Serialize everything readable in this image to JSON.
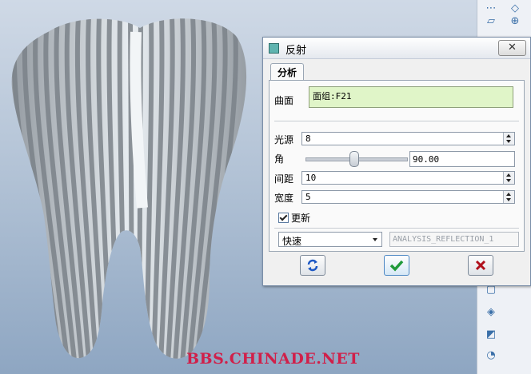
{
  "watermark": "BBS.CHINADE.NET",
  "dialog": {
    "title": "反射",
    "close_glyph": "✕",
    "tab_label": "分析",
    "surface": {
      "label": "曲面",
      "value": "面组:F21"
    },
    "light_source": {
      "label": "光源",
      "value": "8"
    },
    "angle": {
      "label": "角",
      "value": "90.00",
      "slider_fraction": 0.5
    },
    "spacing": {
      "label": "间距",
      "value": "10"
    },
    "width": {
      "label": "宽度",
      "value": "5"
    },
    "update": {
      "label": "更新",
      "checked": true
    },
    "mode": {
      "value": "快速"
    },
    "analysis_name": "ANALYSIS_REFLECTION_1",
    "buttons": [
      "refresh-icon",
      "ok-check-icon",
      "cancel-x-icon"
    ]
  },
  "colors": {
    "surface_field": "#e0f5c8",
    "ok": "#1f9a3a",
    "cancel": "#b0101c",
    "watermark": "#d0204a"
  }
}
